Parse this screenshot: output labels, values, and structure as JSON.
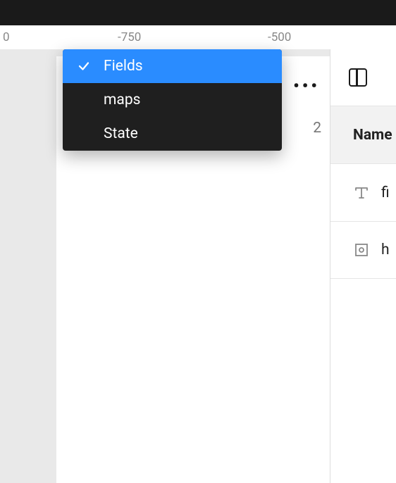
{
  "ruler": {
    "ticks": [
      "0",
      "-750",
      "-500"
    ]
  },
  "dropdown": {
    "items": [
      {
        "label": "Fields",
        "selected": true
      },
      {
        "label": "maps",
        "selected": false
      },
      {
        "label": "State",
        "selected": false
      }
    ]
  },
  "panel": {
    "header_count": "2",
    "column_header": "Name",
    "rows": [
      {
        "icon": "text",
        "label": "fi"
      },
      {
        "icon": "instance",
        "label": "h"
      }
    ]
  },
  "overflow_label": "•••"
}
